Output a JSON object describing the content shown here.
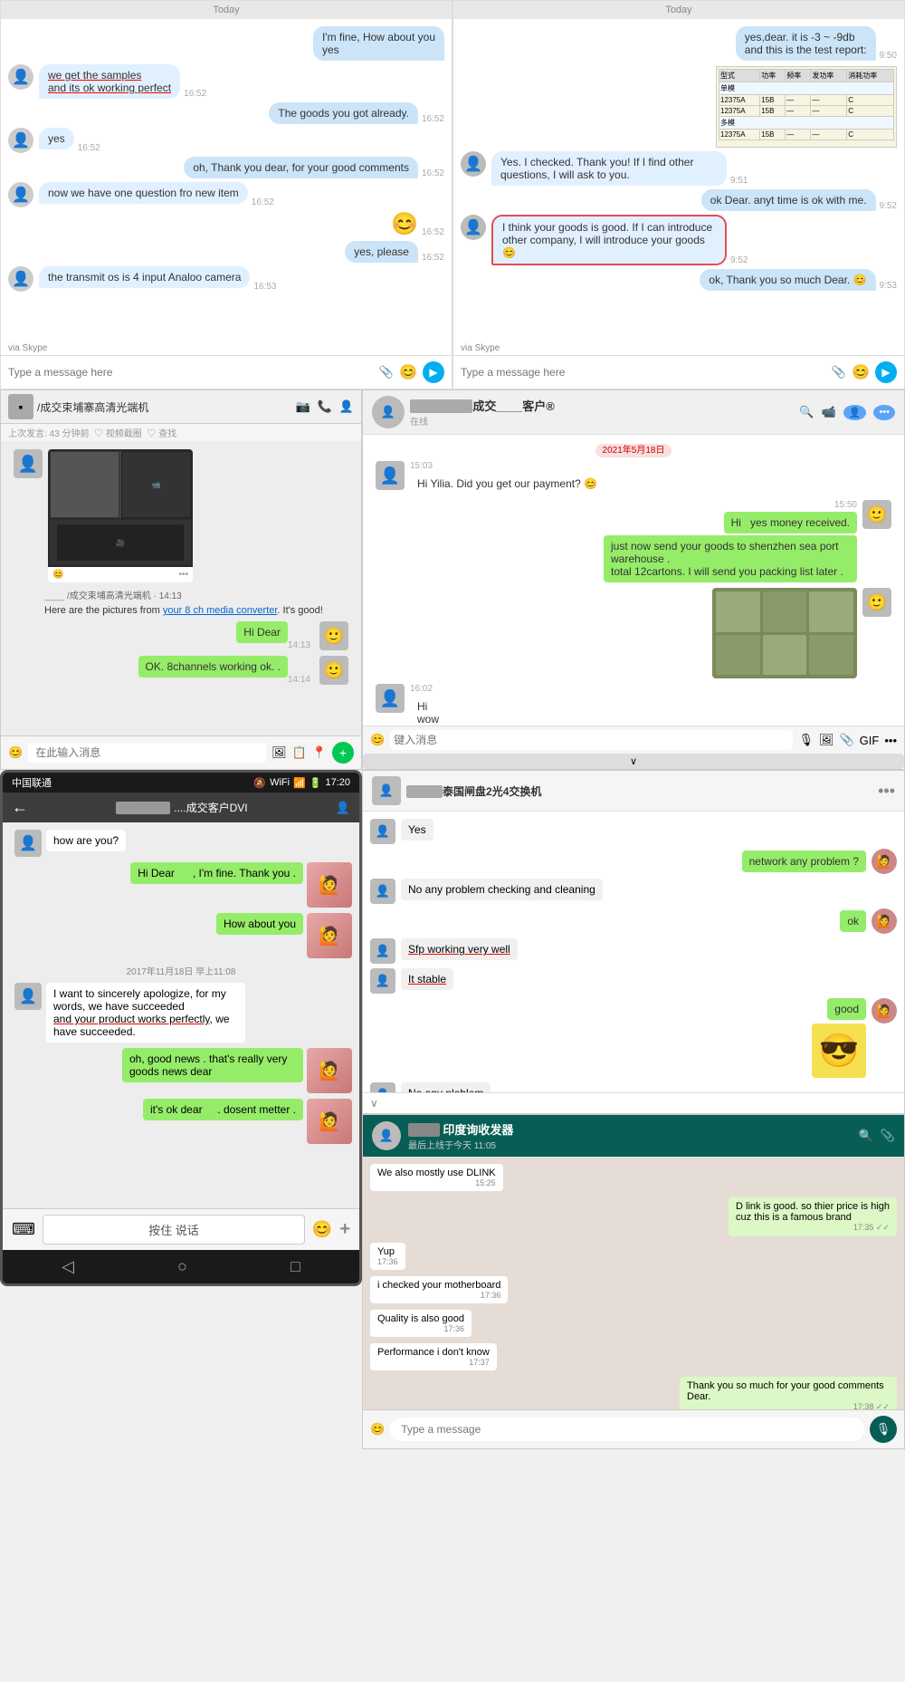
{
  "top_left_chat": {
    "date_label": "Today",
    "messages": [
      {
        "side": "right",
        "text": "I'm fine, How about you\nyes",
        "time": ""
      },
      {
        "side": "left",
        "text": "we get the samples\nand its ok working perfect",
        "time": "16:52",
        "underline": true
      },
      {
        "side": "right",
        "text": "The goods you got already.",
        "time": "16:52"
      },
      {
        "side": "left",
        "text": "yes",
        "time": "16:52"
      },
      {
        "side": "right",
        "text": "oh, Thank you dear, for your good comments",
        "time": "16:52"
      },
      {
        "side": "left",
        "text": "now we have one question fro new item",
        "time": "16:52"
      },
      {
        "side": "right",
        "text": "😊",
        "time": "16:52"
      },
      {
        "side": "right",
        "text": "yes, please",
        "time": "16:52"
      },
      {
        "side": "left",
        "text": "the transmit os  is 4 input Analoo camera",
        "time": "16:53"
      }
    ],
    "input_placeholder": "Type a message here"
  },
  "top_right_chat": {
    "date_label": "Today",
    "messages": [
      {
        "side": "right",
        "text": "yes,dear. it is -3 ~ -9db\nand this is the test report:",
        "time": "9:50"
      },
      {
        "side": "left",
        "text": "Yes. I checked. Thank you! If I find other questions, I will ask to you.",
        "time": "9:51"
      },
      {
        "side": "right",
        "text": "ok Dear. anyt time is ok with me.",
        "time": "9:52"
      },
      {
        "side": "left",
        "text": "I think your goods is good. If I can introduce other company, I will introduce your goods 😊",
        "time": "9:52",
        "highlight": true
      },
      {
        "side": "right",
        "text": "ok, Thank you so much Dear. 😊",
        "time": "9:53"
      }
    ],
    "input_placeholder": "Type a message here",
    "via": "via Skype"
  },
  "middle_left_chat": {
    "title": "/成交束埔寨高清光端机",
    "subtitle": "上次发言: 43 分钟前  ♡ 视频截圈  ♡ 查找",
    "messages": [
      {
        "side": "left",
        "text": "Here are the pictures from your 8 ch media converter. It's good!",
        "time": "14:13",
        "has_image": true
      },
      {
        "side": "right",
        "text": "Hi Dear",
        "time": "14:13"
      },
      {
        "side": "right",
        "text": "OK. 8channels working ok. .",
        "time": "14:14"
      }
    ],
    "input_placeholder": "在此输入消息"
  },
  "middle_right_chat": {
    "title": "成交____客户®",
    "date_section": "2021年5月18日",
    "messages": [
      {
        "side": "left",
        "text": "Hi Yilia. Did you get our payment? 😊",
        "time": "15:03"
      },
      {
        "side": "right",
        "text": "Hi  yes money received.",
        "time": "15:50"
      },
      {
        "side": "right",
        "text": "just now send your goods to shenzhen sea port warehouse .\ntotal 12cartons. I will send you packing list later .",
        "time": ""
      },
      {
        "side": "left",
        "text": "Hi\nwow\ncrazy\nso much 😊",
        "time": "16:02"
      }
    ]
  },
  "bottom_left_phone": {
    "status_bar": {
      "carrier": "中国联通",
      "icons": "🔕 WiFi 📶 🔋",
      "time": "17:20"
    },
    "title": "....成交客户DVI",
    "messages": [
      {
        "side": "left",
        "text": "how are you?"
      },
      {
        "side": "right",
        "text": "Hi Dear      , I'm fine. Thank you ."
      },
      {
        "side": "right",
        "text": "How about you"
      },
      {
        "side": "system",
        "text": "2017年11月18日 早上11:08"
      },
      {
        "side": "left",
        "text": "I want to sincerely apologize, for my words, we have succeeded and your product works perfectly, we have succeeded."
      },
      {
        "side": "right",
        "text": "oh, good news . that's really very goods news dear"
      },
      {
        "side": "right",
        "text": "it's ok dear       . dosent metter ."
      }
    ],
    "footer_label": "按住 说话"
  },
  "bottom_right_chat": {
    "title": "泰国闸盘2光4交换机",
    "messages": [
      {
        "side": "left",
        "text": "Yes"
      },
      {
        "side": "right",
        "text": "network any problem ?"
      },
      {
        "side": "left",
        "text": "No any problem  checking and cleaning"
      },
      {
        "side": "right",
        "text": "ok"
      },
      {
        "side": "left",
        "text": "Sfp working very well",
        "underline": true
      },
      {
        "side": "left",
        "text": "It stable",
        "underline": true
      },
      {
        "side": "right",
        "text": "good"
      },
      {
        "side": "left",
        "text": "No any ploblem",
        "underline": true
      }
    ]
  },
  "whatsapp_chat": {
    "title": "印度询收发器",
    "subtitle": "最后上线于今天 11:05",
    "messages": [
      {
        "side": "left",
        "text": "We also mostly use DLINK",
        "time": "15:25"
      },
      {
        "side": "right",
        "text": "D link is good. so thier price is high\ncuz this is a famous brand",
        "time": "17:35"
      },
      {
        "side": "left",
        "text": "Yup",
        "time": "17:36"
      },
      {
        "side": "left",
        "text": "i checked your motherboard",
        "time": "17:36"
      },
      {
        "side": "left",
        "text": "Quality is also good",
        "time": "17:36"
      },
      {
        "side": "left",
        "text": "Performance i don't know",
        "time": "17:37"
      },
      {
        "side": "right",
        "text": "Thank you so much for your good comments Dear.",
        "time": "17:38"
      }
    ]
  }
}
